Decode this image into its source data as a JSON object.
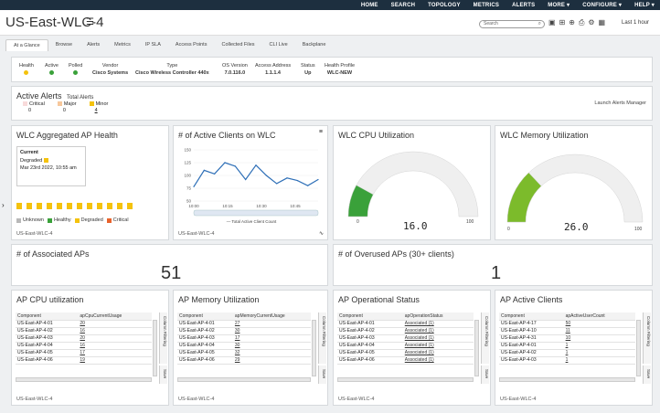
{
  "topnav": [
    "HOME",
    "SEARCH",
    "TOPOLOGY",
    "METRICS",
    "ALERTS",
    "MORE",
    "CONFIGURE",
    "HELP"
  ],
  "header": {
    "title": "US-East-WLC-4",
    "search_placeholder": "Search",
    "time_range": "Last 1 hour"
  },
  "tabs": [
    "At a Glance",
    "Browse",
    "Alerts",
    "Metrics",
    "IP SLA",
    "Access Points",
    "Collected Files",
    "CLI Live",
    "Backplane"
  ],
  "info": [
    {
      "label": "Health",
      "value": "",
      "status": "yellow"
    },
    {
      "label": "Active",
      "value": "",
      "status": "green"
    },
    {
      "label": "Polled",
      "value": "",
      "status": "green"
    },
    {
      "label": "Vendor",
      "value": "Cisco Systems"
    },
    {
      "label": "Type",
      "value": "Cisco Wireless Controller 440x"
    },
    {
      "label": "OS Version",
      "value": "7.0.116.0"
    },
    {
      "label": "Access Address",
      "value": "1.1.1.4"
    },
    {
      "label": "Status",
      "value": "Up"
    },
    {
      "label": "Health Profile",
      "value": "WLC-NEW"
    }
  ],
  "alerts": {
    "title": "Active Alerts",
    "total_label": "Total Alerts",
    "launch": "Launch Alerts Manager",
    "items": [
      {
        "label": "Critical",
        "value": "0",
        "color": "#f8dada"
      },
      {
        "label": "Major",
        "value": "0",
        "color": "#f7c89c"
      },
      {
        "label": "Minor",
        "value": "4",
        "color": "#f4c20d"
      }
    ]
  },
  "ap_health": {
    "title": "WLC Aggregated AP Health",
    "current_label": "Current",
    "state": "Degraded",
    "date": "Mar 23rd 2022, 10:55 am",
    "footer": "US-East-WLC-4",
    "legend": [
      {
        "label": "Unknown",
        "color": "#b8b8b8"
      },
      {
        "label": "Healthy",
        "color": "#3aa13a"
      },
      {
        "label": "Degraded",
        "color": "#f4c20d"
      },
      {
        "label": "Critical",
        "color": "#e8632c"
      }
    ]
  },
  "active_clients": {
    "title": "# of Active Clients on WLC",
    "footer": "US-East-WLC-4",
    "legend": "Total Active Client Count",
    "chart_data": {
      "type": "line",
      "x": [
        "10:05",
        "10:10",
        "10:15",
        "10:20",
        "10:25",
        "10:30",
        "10:35",
        "10:40",
        "10:45",
        "10:50",
        "10:55",
        "11:00",
        "11:05"
      ],
      "y": [
        78,
        110,
        103,
        125,
        118,
        92,
        120,
        100,
        84,
        95,
        90,
        80,
        92
      ],
      "yticks": [
        50,
        75,
        100,
        125,
        150
      ],
      "xticks": [
        "10:00",
        "10:15",
        "10:30",
        "10:45"
      ],
      "ylim": [
        50,
        150
      ]
    }
  },
  "cpu": {
    "title": "WLC CPU Utilization",
    "value": "16.0",
    "min": "0",
    "max": "100",
    "fraction": 0.16,
    "color": "#3aa13a"
  },
  "memory": {
    "title": "WLC Memory Utilization",
    "value": "26.0",
    "min": "0",
    "max": "100",
    "fraction": 0.26,
    "color": "#7cbb2b"
  },
  "assoc": {
    "title": "# of Associated APs",
    "value": "51"
  },
  "overused": {
    "title": "# of Overused APs (30+ clients)",
    "value": "1"
  },
  "ap_cpu": {
    "title": "AP CPU utilization",
    "col1": "Component",
    "col2": "apCpuCurrentUsage",
    "footer": "US-East-WLC-4",
    "rows": [
      [
        "US-East-AP-4-01",
        "20"
      ],
      [
        "US-East-AP-4-02",
        "16"
      ],
      [
        "US-East-AP-4-03",
        "20"
      ],
      [
        "US-East-AP-4-04",
        "16"
      ],
      [
        "US-East-AP-4-05",
        "17"
      ],
      [
        "US-East-AP-4-06",
        "19"
      ]
    ]
  },
  "ap_mem": {
    "title": "AP Memory Utilization",
    "col1": "Component",
    "col2": "apMemoryCurrentUsage",
    "footer": "US-East-WLC-4",
    "rows": [
      [
        "US-East-AP-4-01",
        "27"
      ],
      [
        "US-East-AP-4-02",
        "30"
      ],
      [
        "US-East-AP-4-03",
        "17"
      ],
      [
        "US-East-AP-4-04",
        "30"
      ],
      [
        "US-East-AP-4-05",
        "32"
      ],
      [
        "US-East-AP-4-06",
        "29"
      ]
    ]
  },
  "ap_op": {
    "title": "AP Operational Status",
    "col1": "Component",
    "col2": "apOperationStatus",
    "footer": "US-East-WLC-4",
    "rows": [
      [
        "US-East-AP-4-01",
        "Associated (1)"
      ],
      [
        "US-East-AP-4-02",
        "Associated (1)"
      ],
      [
        "US-East-AP-4-03",
        "Associated (1)"
      ],
      [
        "US-East-AP-4-04",
        "Associated (1)"
      ],
      [
        "US-East-AP-4-05",
        "Associated (1)"
      ],
      [
        "US-East-AP-4-06",
        "Associated (1)"
      ]
    ]
  },
  "ap_clients": {
    "title": "AP Active Clients",
    "col1": "Component",
    "col2": "apActiveUserCount",
    "footer": "US-East-WLC-4",
    "rows": [
      [
        "US-East-AP-4-17",
        "50"
      ],
      [
        "US-East-AP-4-10",
        "11"
      ],
      [
        "US-East-AP-4-31",
        "10"
      ],
      [
        "US-East-AP-4-01",
        "1"
      ],
      [
        "US-East-AP-4-02",
        "1"
      ],
      [
        "US-East-AP-4-03",
        "1"
      ]
    ]
  },
  "column_filtering": "Column Filtering",
  "save": "Save"
}
